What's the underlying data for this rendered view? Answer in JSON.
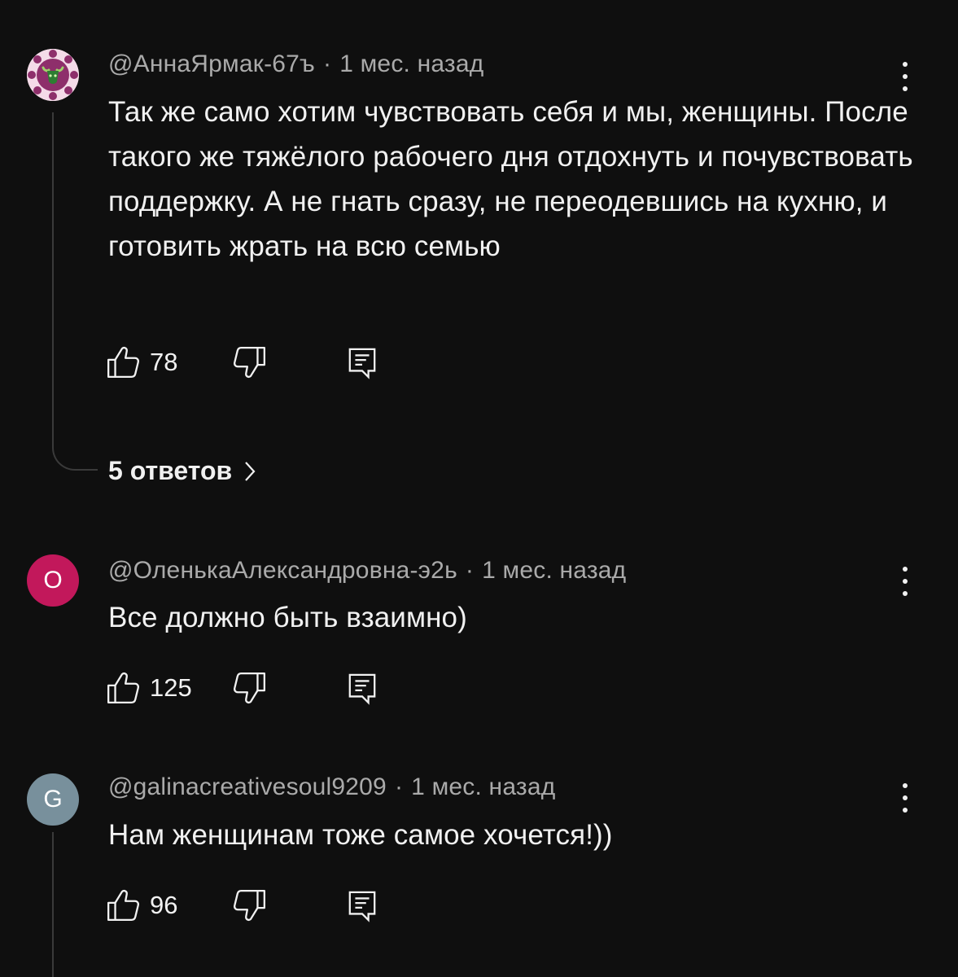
{
  "comments": [
    {
      "author": "@АннаЯрмак-67ъ",
      "time": "1 мес. назад",
      "dot": "·",
      "text": "Так же само хотим чувствовать себя и мы, женщины. После такого же тяжёлого рабочего дня отдохнуть и почувствовать поддержку. А не гнать сразу, не переодевшись на кухню, и готовить жрать на всю семью",
      "likes": "78",
      "replies_label": "5 ответов",
      "avatar_bg": "#8a3a6e"
    },
    {
      "author": "@ОленькаАлександровна-э2ь",
      "time": "1 мес. назад",
      "dot": "·",
      "text": "Все должно быть взаимно)",
      "likes": "125",
      "avatar_letter": "О",
      "avatar_bg": "#c2185b"
    },
    {
      "author": "@galinacreativesoul9209",
      "time": "1 мес. назад",
      "dot": "·",
      "text": "Нам женщинам тоже самое хочется!))",
      "likes": "96",
      "avatar_letter": "G",
      "avatar_bg": "#78909c"
    }
  ],
  "icons": {
    "like": "thumbs-up-icon",
    "dislike": "thumbs-down-icon",
    "reply": "reply-comment-icon",
    "more": "more-vertical-icon",
    "chevron": "chevron-right-icon"
  },
  "colors": {
    "background": "#0f0f0f",
    "text": "#f1f1f1",
    "secondary": "#aaaaaa"
  }
}
